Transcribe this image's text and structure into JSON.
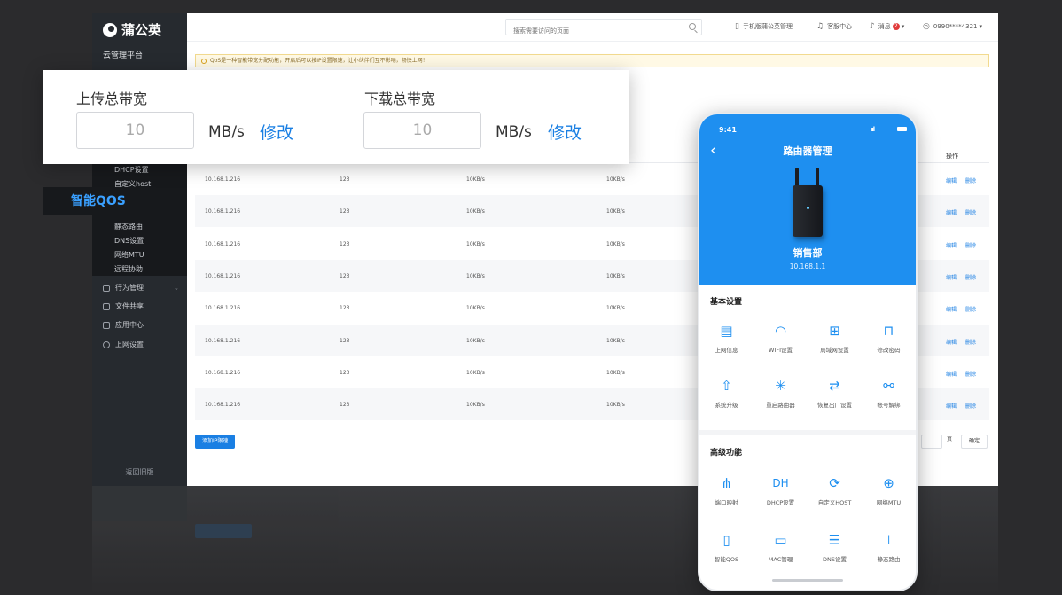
{
  "sidebar": {
    "logo": "蒲公英",
    "platform": "云管理平台",
    "subitems": [
      "DHCP设置",
      "自定义host",
      "静态路由",
      "DNS设置",
      "网络MTU",
      "远程协助"
    ],
    "nav": [
      "行为管理",
      "文件共享",
      "应用中心",
      "上网设置"
    ],
    "old_version": "返回旧版"
  },
  "topbar": {
    "search_placeholder": "搜索需要访问的页面",
    "mobile_manage": "手机版蒲公英管理",
    "support": "客服中心",
    "messages": "消息",
    "message_count": "2",
    "account": "0990****4321"
  },
  "notice": "QoS是一种智能带宽分配功能，开启后可以按IP设置限速，让小伙伴们互不影响，畅快上网！",
  "table": {
    "op_header": "操作",
    "rows": [
      {
        "ip": "10.168.1.216",
        "num": "123",
        "up": "10KB/s",
        "down": "10KB/s"
      },
      {
        "ip": "10.168.1.216",
        "num": "123",
        "up": "10KB/s",
        "down": "10KB/s"
      },
      {
        "ip": "10.168.1.216",
        "num": "123",
        "up": "10KB/s",
        "down": "10KB/s"
      },
      {
        "ip": "10.168.1.216",
        "num": "123",
        "up": "10KB/s",
        "down": "10KB/s"
      },
      {
        "ip": "10.168.1.216",
        "num": "123",
        "up": "10KB/s",
        "down": "10KB/s"
      },
      {
        "ip": "10.168.1.216",
        "num": "123",
        "up": "10KB/s",
        "down": "10KB/s"
      },
      {
        "ip": "10.168.1.216",
        "num": "123",
        "up": "10KB/s",
        "down": "10KB/s"
      },
      {
        "ip": "10.168.1.216",
        "num": "123",
        "up": "10KB/s",
        "down": "10KB/s"
      }
    ],
    "edit": "编辑",
    "delete": "删除",
    "add_button": "添加IP限速",
    "page_suffix": "页",
    "confirm": "确定"
  },
  "bandwidth": {
    "upload_title": "上传总带宽",
    "upload_value": "10",
    "download_title": "下载总带宽",
    "download_value": "10",
    "unit": "MB/s",
    "edit": "修改"
  },
  "qos_label": "智能QOS",
  "phone": {
    "time": "9:41",
    "signal": "ııl",
    "title": "路由器管理",
    "dept": "销售部",
    "ip": "10.168.1.1",
    "basic_title": "基本设置",
    "basic": [
      {
        "label": "上网信息",
        "icon": "document-icon",
        "glyph": "▤"
      },
      {
        "label": "WIFI设置",
        "icon": "wifi-icon",
        "glyph": "◠"
      },
      {
        "label": "局域网设置",
        "icon": "lan-icon",
        "glyph": "⊞"
      },
      {
        "label": "修改密码",
        "icon": "lock-icon",
        "glyph": "⊓"
      },
      {
        "label": "系统升级",
        "icon": "upgrade-icon",
        "glyph": "⇧"
      },
      {
        "label": "重启路由器",
        "icon": "restart-icon",
        "glyph": "✳"
      },
      {
        "label": "恢复出厂设置",
        "icon": "reset-icon",
        "glyph": "⇄"
      },
      {
        "label": "帐号解绑",
        "icon": "unlink-icon",
        "glyph": "⚯"
      }
    ],
    "advanced_title": "高级功能",
    "advanced": [
      {
        "label": "端口映射",
        "icon": "port-mapping-icon",
        "glyph": "⋔"
      },
      {
        "label": "DHCP设置",
        "icon": "dhcp-icon",
        "glyph": "DH"
      },
      {
        "label": "自定义HOST",
        "icon": "host-icon",
        "glyph": "⟳"
      },
      {
        "label": "网络MTU",
        "icon": "globe-icon",
        "glyph": "⊕"
      },
      {
        "label": "智能QOS",
        "icon": "qos-icon",
        "glyph": "▯"
      },
      {
        "label": "MAC管理",
        "icon": "mac-icon",
        "glyph": "▭"
      },
      {
        "label": "DNS设置",
        "icon": "dns-icon",
        "glyph": "☰"
      },
      {
        "label": "静态路由",
        "icon": "route-icon",
        "glyph": "⊥"
      }
    ]
  },
  "colors": {
    "accent": "#1a7fe3",
    "phone_header": "#1e8ff0",
    "sidebar": "#262a2f"
  }
}
